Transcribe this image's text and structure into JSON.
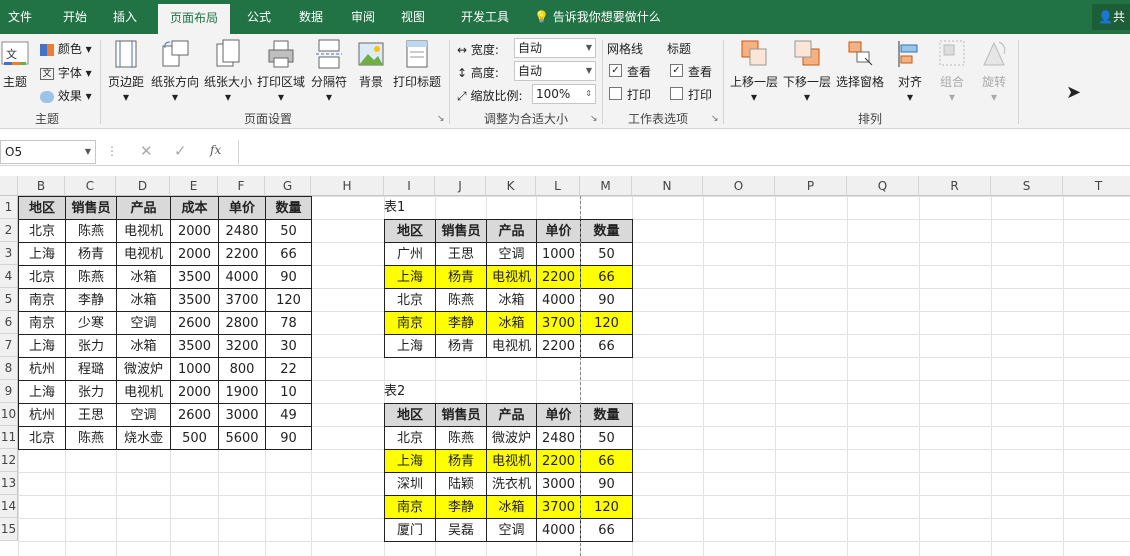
{
  "tabs": [
    "文件",
    "开始",
    "插入",
    "页面布局",
    "公式",
    "数据",
    "审阅",
    "视图",
    "开发工具"
  ],
  "tell": "告诉我你想要做什么",
  "share": "共",
  "ribbon": {
    "theme": {
      "main": "主题",
      "colors": "颜色",
      "fonts": "字体",
      "effects": "效果",
      "group": "主题"
    },
    "setup": {
      "margins": "页边距",
      "orientation": "纸张方向",
      "size": "纸张大小",
      "area": "打印区域",
      "breaks": "分隔符",
      "background": "背景",
      "titles": "打印标题",
      "group": "页面设置"
    },
    "scale": {
      "width_label": "宽度:",
      "width_value": "自动",
      "height_label": "高度:",
      "height_value": "自动",
      "scale_label": "缩放比例:",
      "scale_value": "100%",
      "group": "调整为合适大小"
    },
    "sheet": {
      "gridlines": "网格线",
      "headings": "标题",
      "view1": "查看",
      "view2": "查看",
      "print1": "打印",
      "print2": "打印",
      "group": "工作表选项"
    },
    "arrange": {
      "forward": "上移一层",
      "backward": "下移一层",
      "pane": "选择窗格",
      "align": "对齐",
      "group_btn": "组合",
      "rotate": "旋转",
      "group": "排列"
    }
  },
  "namebox": "O5",
  "fx": "fx",
  "columns": [
    "B",
    "C",
    "D",
    "E",
    "F",
    "G",
    "H",
    "I",
    "J",
    "K",
    "L",
    "M",
    "N",
    "O",
    "P",
    "Q",
    "R",
    "S",
    "T"
  ],
  "rows": [
    "1",
    "2",
    "3",
    "4",
    "5",
    "6",
    "7",
    "8",
    "9",
    "10",
    "11",
    "12",
    "13",
    "14",
    "15"
  ],
  "table_main": {
    "headers": [
      "地区",
      "销售员",
      "产品",
      "成本",
      "单价",
      "数量"
    ],
    "rows": [
      [
        "北京",
        "陈燕",
        "电视机",
        "2000",
        "2480",
        "50"
      ],
      [
        "上海",
        "杨青",
        "电视机",
        "2000",
        "2200",
        "66"
      ],
      [
        "北京",
        "陈燕",
        "冰箱",
        "3500",
        "4000",
        "90"
      ],
      [
        "南京",
        "李静",
        "冰箱",
        "3500",
        "3700",
        "120"
      ],
      [
        "南京",
        "少寒",
        "空调",
        "2600",
        "2800",
        "78"
      ],
      [
        "上海",
        "张力",
        "冰箱",
        "3500",
        "3200",
        "30"
      ],
      [
        "杭州",
        "程璐",
        "微波炉",
        "1000",
        "800",
        "22"
      ],
      [
        "上海",
        "张力",
        "电视机",
        "2000",
        "1900",
        "10"
      ],
      [
        "杭州",
        "王思",
        "空调",
        "2600",
        "3000",
        "49"
      ],
      [
        "北京",
        "陈燕",
        "烧水壶",
        "500",
        "5600",
        "90"
      ]
    ]
  },
  "table1": {
    "title": "表1",
    "headers": [
      "地区",
      "销售员",
      "产品",
      "单价",
      "数量"
    ],
    "rows": [
      [
        "广州",
        "王思",
        "空调",
        "1000",
        "50"
      ],
      [
        "上海",
        "杨青",
        "电视机",
        "2200",
        "66"
      ],
      [
        "北京",
        "陈燕",
        "冰箱",
        "4000",
        "90"
      ],
      [
        "南京",
        "李静",
        "冰箱",
        "3700",
        "120"
      ],
      [
        "上海",
        "杨青",
        "电视机",
        "2200",
        "66"
      ]
    ],
    "highlight": [
      false,
      true,
      false,
      true,
      false
    ]
  },
  "table2": {
    "title": "表2",
    "headers": [
      "地区",
      "销售员",
      "产品",
      "单价",
      "数量"
    ],
    "rows": [
      [
        "北京",
        "陈燕",
        "微波炉",
        "2480",
        "50"
      ],
      [
        "上海",
        "杨青",
        "电视机",
        "2200",
        "66"
      ],
      [
        "深圳",
        "陆颖",
        "洗衣机",
        "3000",
        "90"
      ],
      [
        "南京",
        "李静",
        "冰箱",
        "3700",
        "120"
      ],
      [
        "厦门",
        "吴磊",
        "空调",
        "4000",
        "66"
      ]
    ],
    "highlight": [
      false,
      true,
      false,
      true,
      false
    ]
  },
  "colors": {
    "excel_green": "#217346",
    "highlight": "#ffff00",
    "header_fill": "#d9d9d9"
  }
}
